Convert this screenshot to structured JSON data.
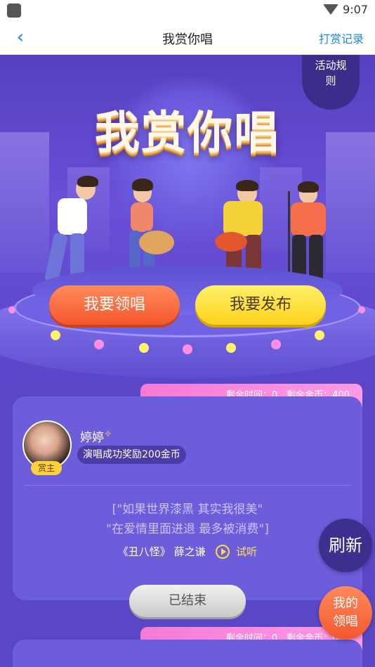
{
  "status_bar": {
    "time": "9:07"
  },
  "nav": {
    "title": "我赏你唱",
    "record_label": "打赏记录",
    "back_icon": "back-arrow-icon"
  },
  "hero": {
    "rules_label": "活动规\n则",
    "title": "我赏你唱",
    "lead_button": "我要领唱",
    "publish_button": "我要发布"
  },
  "cards": [
    {
      "remaining_label": "剩余时间：0　剩余金币：400",
      "host_badge": "赏主",
      "user_name": "婷婷",
      "reward": "演唱成功奖励200金币",
      "lyric_1": "[\"如果世界漆黑 其实我很美\"",
      "lyric_2": "\"在爱情里面进退 最多被消费\"]",
      "song_title": "《丑八怪》",
      "singer": "薛之谦",
      "listen_label": "试听",
      "status_button": "已结束"
    },
    {
      "remaining_label": "剩余时间：0　剩余金币：000"
    }
  ],
  "floating": {
    "refresh_label": "刷新",
    "my_lead_label": "我的\n领唱"
  },
  "colors": {
    "accent_blue": "#1e88e5",
    "lead_orange": "#f4572c",
    "publish_yellow": "#ffd21e",
    "tab_pink": "#f77ad6"
  }
}
